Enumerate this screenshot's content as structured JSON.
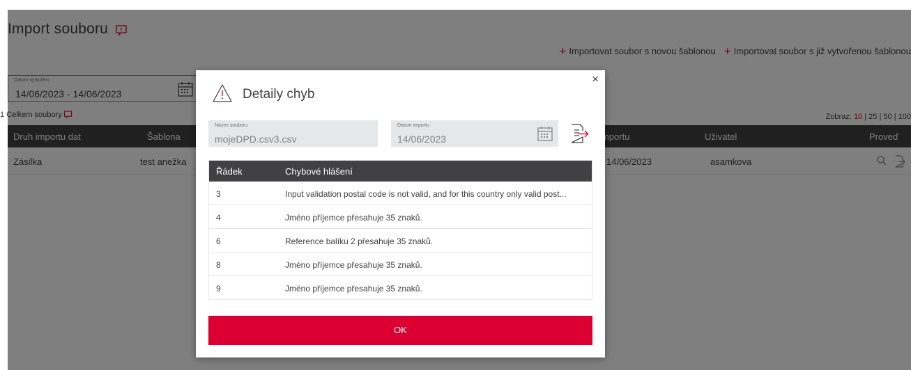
{
  "page": {
    "title": "Import souboru",
    "import_links": [
      "Importovat soubor s novou šablonou",
      "Importovat soubor s již vytvořenou šablonou"
    ],
    "date_filter": {
      "label": "Datum vytvoření",
      "value": "14/06/2023 - 14/06/2023"
    },
    "count_text": "1 Celkem soubory",
    "pager": {
      "label": "Zobraz:",
      "options": [
        "10",
        "25",
        "50",
        "100"
      ],
      "separator": "|"
    },
    "table": {
      "headers": [
        "Druh importu dat",
        "Šablona",
        "mportu",
        "Uživatel",
        "Proveď"
      ],
      "rows": [
        {
          "type": "Zásilka",
          "template": "test anežka",
          "date": "14/06/2023",
          "user": "asamkova"
        }
      ]
    }
  },
  "modal": {
    "title": "Detaily chyb",
    "close": "×",
    "file_field": {
      "label": "Název souboru",
      "value": "mojeDPD.csv3.csv"
    },
    "date_field": {
      "label": "Datum importu",
      "value": "14/06/2023"
    },
    "error_table": {
      "headers": [
        "Řádek",
        "Chybové hlášení"
      ],
      "rows": [
        {
          "line": "3",
          "message": "Input validation postal code is not valid, and for this country only valid post..."
        },
        {
          "line": "4",
          "message": "Jméno příjemce přesahuje 35 znaků."
        },
        {
          "line": "6",
          "message": "Reference balíku 2 přesahuje 35 znaků."
        },
        {
          "line": "8",
          "message": "Jméno příjemce přesahuje 35 znaků."
        },
        {
          "line": "9",
          "message": "Jméno příjemce přesahuje 35 znaků."
        }
      ]
    },
    "ok_label": "OK"
  },
  "colors": {
    "accent": "#dc0032",
    "dark": "#414042",
    "overlay": "rgba(0,0,0,0.5)"
  },
  "icons": [
    "comment-info-icon",
    "plus-icon",
    "calendar-icon",
    "warning-icon",
    "export-file-icon",
    "search-icon",
    "close-icon"
  ]
}
